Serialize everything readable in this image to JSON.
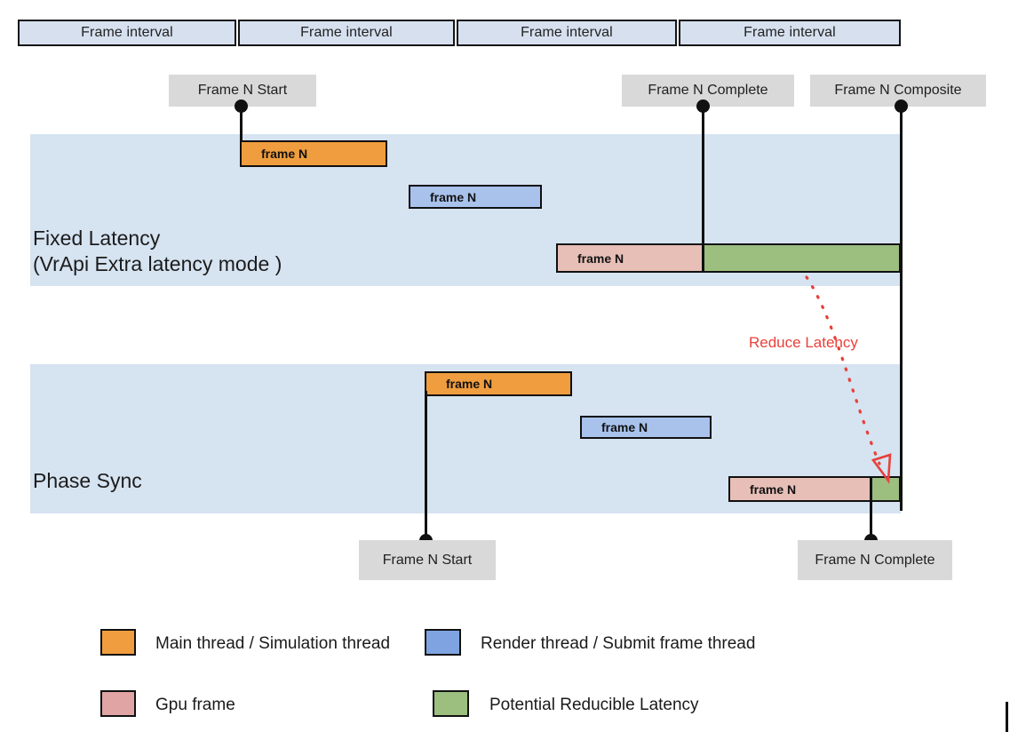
{
  "title": "Fixed Latency vs Phase Sync frame timing diagram",
  "timeline": {
    "intervals": [
      {
        "label": "Frame interval"
      },
      {
        "label": "Frame interval"
      },
      {
        "label": "Frame interval"
      },
      {
        "label": "Frame interval"
      }
    ]
  },
  "events": {
    "top": [
      {
        "label": "Frame N Start"
      },
      {
        "label": "Frame N Complete"
      },
      {
        "label": "Frame N Composite"
      }
    ],
    "bottom": [
      {
        "label": "Frame N Start"
      },
      {
        "label": "Frame N Complete"
      }
    ]
  },
  "lanes": [
    {
      "name": "fixed-latency",
      "label": "Fixed Latency\n(VrApi Extra latency mode )",
      "bars": [
        {
          "kind": "main-thread",
          "label": "frame N"
        },
        {
          "kind": "render-thread",
          "label": "frame N"
        },
        {
          "kind": "gpu-frame",
          "label": "frame N"
        },
        {
          "kind": "reducible-latency",
          "label": ""
        }
      ]
    },
    {
      "name": "phase-sync",
      "label": "Phase Sync",
      "bars": [
        {
          "kind": "main-thread",
          "label": "frame N"
        },
        {
          "kind": "render-thread",
          "label": "frame N"
        },
        {
          "kind": "gpu-frame",
          "label": "frame N"
        },
        {
          "kind": "reducible-latency",
          "label": ""
        }
      ]
    }
  ],
  "annotation": {
    "reduce_latency_label": "Reduce Latency",
    "color": "#e8403a"
  },
  "legend": {
    "items": [
      {
        "key": "main-thread",
        "label": "Main thread / Simulation thread",
        "color": "#ef9d3e"
      },
      {
        "key": "render-thread",
        "label": "Render thread / Submit frame thread",
        "color": "#7fa3e0"
      },
      {
        "key": "gpu-frame",
        "label": "Gpu frame",
        "color": "#e0a4a4"
      },
      {
        "key": "reducible-latency",
        "label": "Potential Reducible  Latency",
        "color": "#9cbe7f"
      }
    ]
  },
  "colors": {
    "band": "#d6e3f1",
    "interval_fill": "#d6e0ef",
    "event_box": "#d9d9d9",
    "orange": "#ef9d3e",
    "blue": "#a8c2ec",
    "pink": "#e7bfb7",
    "green": "#9cbe7f",
    "stroke": "#111111"
  }
}
